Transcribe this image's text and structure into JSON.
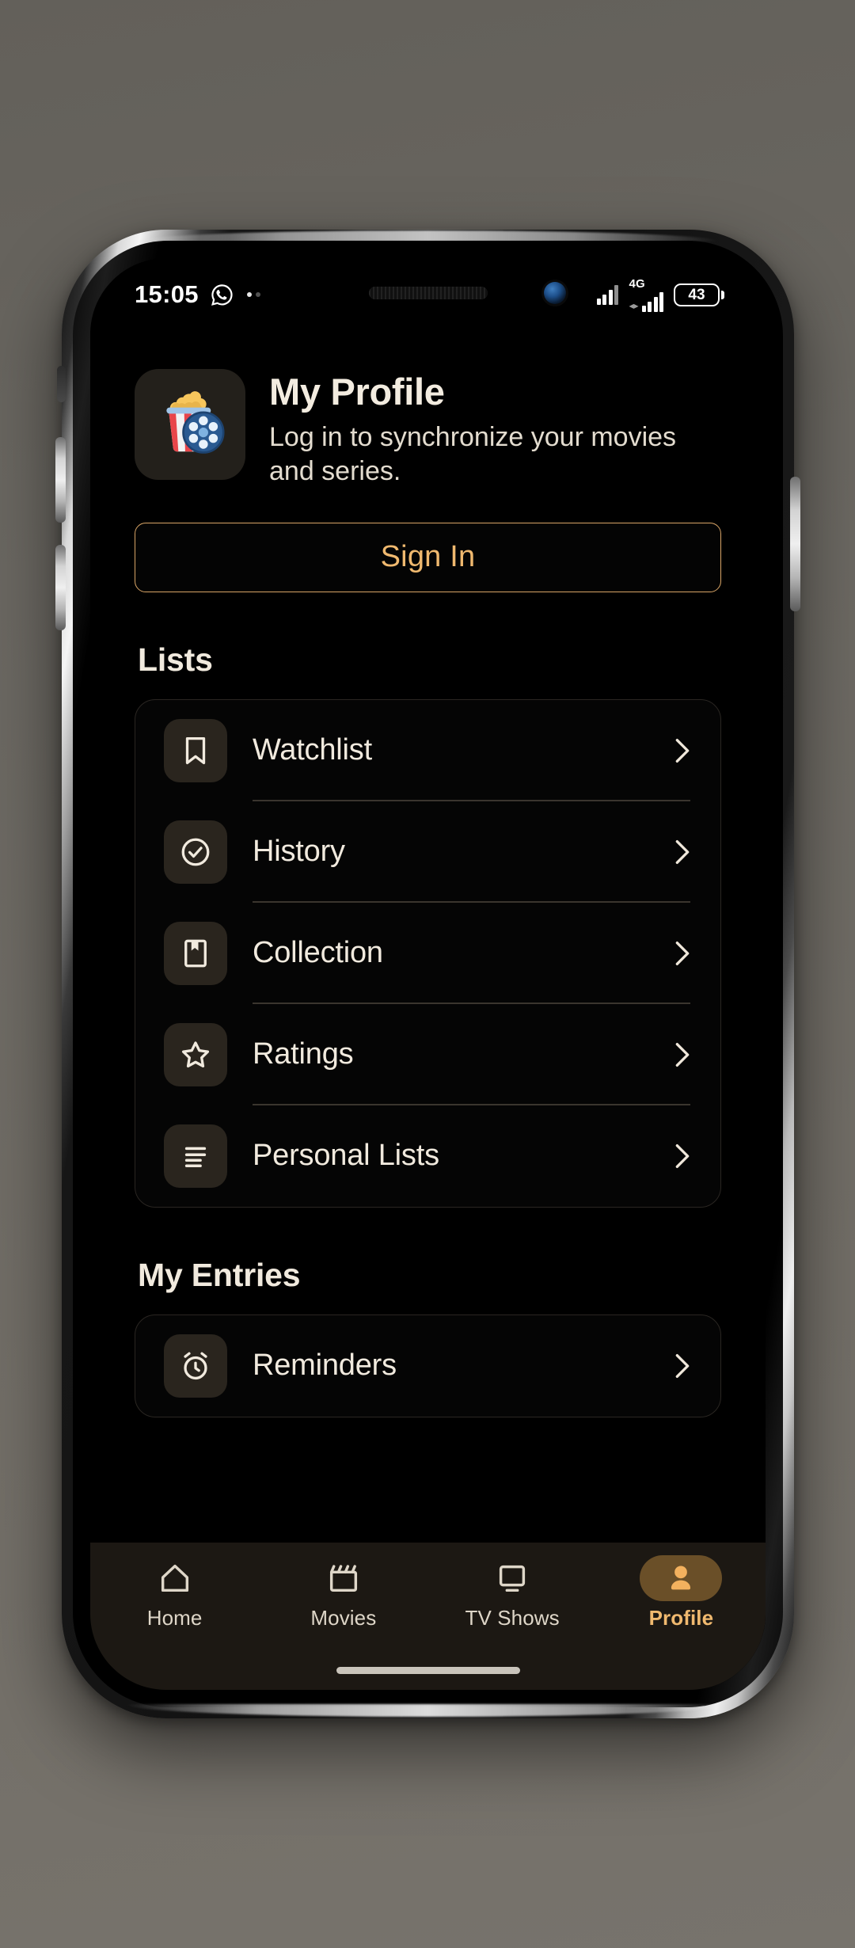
{
  "status_bar": {
    "time": "15:05",
    "left_icons": [
      "whatsapp-icon",
      "more-dots-icon"
    ],
    "network_label": "4G",
    "battery_level": "43",
    "signal_icons": [
      "signal-bars-icon",
      "signal-bars-icon"
    ]
  },
  "header": {
    "title": "My Profile",
    "subtitle": "Log in to synchronize your movies and series.",
    "logo_icon": "popcorn-film-reel-icon"
  },
  "sign_in": {
    "label": "Sign In",
    "border_color": "#d9a566",
    "text_color": "#f0b96f"
  },
  "sections": [
    {
      "title": "Lists",
      "items": [
        {
          "label": "Watchlist",
          "icon": "bookmark-icon",
          "chevron": "chevron-right-icon"
        },
        {
          "label": "History",
          "icon": "check-circle-icon",
          "chevron": "chevron-right-icon"
        },
        {
          "label": "Collection",
          "icon": "book-mark-icon",
          "chevron": "chevron-right-icon"
        },
        {
          "label": "Ratings",
          "icon": "star-icon",
          "chevron": "chevron-right-icon"
        },
        {
          "label": "Personal Lists",
          "icon": "list-lines-icon",
          "chevron": "chevron-right-icon"
        }
      ]
    },
    {
      "title": "My Entries",
      "items": [
        {
          "label": "Reminders",
          "icon": "alarm-clock-icon",
          "chevron": "chevron-right-icon"
        }
      ]
    }
  ],
  "bottom_nav": {
    "items": [
      {
        "label": "Home",
        "icon": "home-icon",
        "active": false
      },
      {
        "label": "Movies",
        "icon": "clapperboard-icon",
        "active": false
      },
      {
        "label": "TV Shows",
        "icon": "monitor-icon",
        "active": false
      },
      {
        "label": "Profile",
        "icon": "person-icon",
        "active": true
      }
    ],
    "active_pill_color": "#6a4f28",
    "active_text_color": "#f0b96f"
  },
  "theme": {
    "screen_bg": "#000000",
    "card_border": "#2a2622",
    "icon_tile_bg": "#2a251e",
    "text_primary": "#f1eade",
    "nav_bg": "#1c1813"
  }
}
